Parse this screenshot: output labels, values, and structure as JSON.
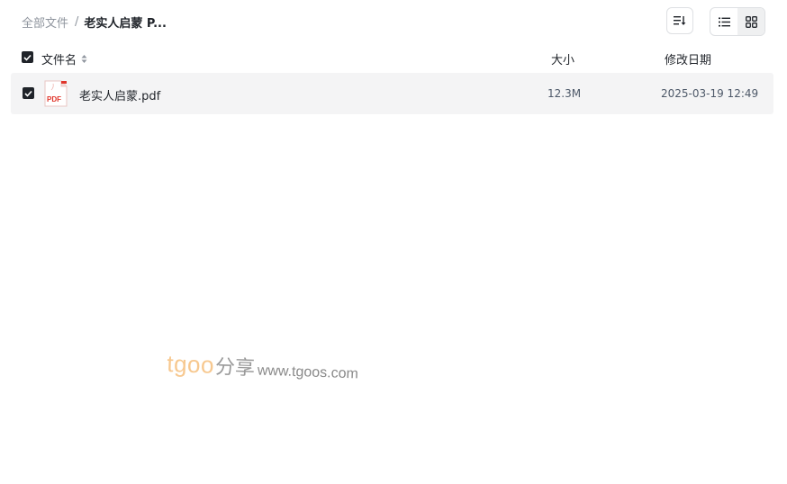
{
  "breadcrumb": {
    "root": "全部文件",
    "separator": "/",
    "current": "老实人启蒙 P..."
  },
  "toolbar": {
    "sort_icon": "sort-lines-icon",
    "list_view_icon": "list-view-icon",
    "grid_view_icon": "grid-view-icon",
    "active_view": "grid"
  },
  "table": {
    "headers": {
      "name": "文件名",
      "size": "大小",
      "modified": "修改日期"
    },
    "select_all_checked": true,
    "rows": [
      {
        "checked": true,
        "icon": "pdf-file-icon",
        "icon_label": "PDF",
        "name": "老实人启蒙.pdf",
        "size": "12.3M",
        "modified": "2025-03-19 12:49"
      }
    ]
  },
  "watermark": {
    "brand": "tgoo",
    "share": "分享",
    "url": "www.tgoos.com"
  },
  "colors": {
    "text_primary": "#1f2329",
    "text_muted": "#8f959e",
    "row_bg": "#f4f4f5",
    "pdf_red": "#e0352b",
    "watermark_brand": "#f7c88f"
  }
}
